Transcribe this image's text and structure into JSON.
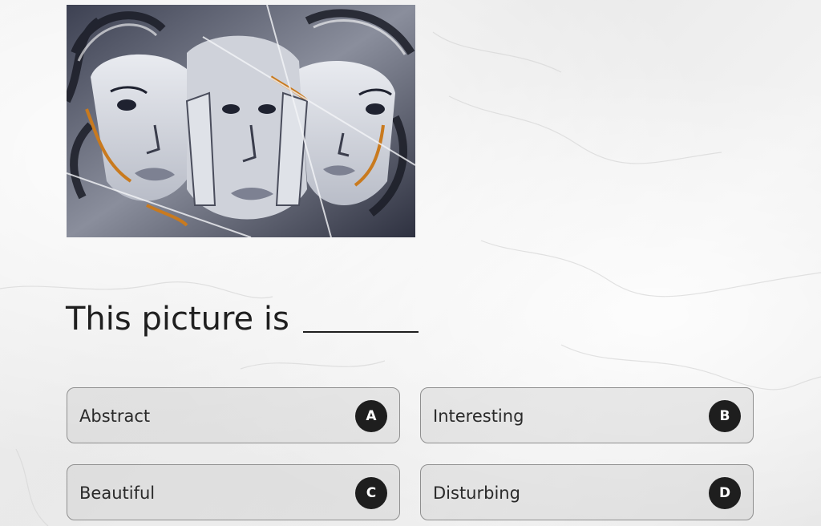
{
  "question": {
    "text": "This picture is"
  },
  "image": {
    "subject": "street mural of overlapping faces"
  },
  "options": [
    {
      "label": "Abstract",
      "letter": "A"
    },
    {
      "label": "Interesting",
      "letter": "B"
    },
    {
      "label": "Beautiful",
      "letter": "C"
    },
    {
      "label": "Disturbing",
      "letter": "D"
    }
  ],
  "colors": {
    "badge_background": "#1e1e1e",
    "text": "#1f1f1f",
    "option_border": "#8f8f8f"
  }
}
